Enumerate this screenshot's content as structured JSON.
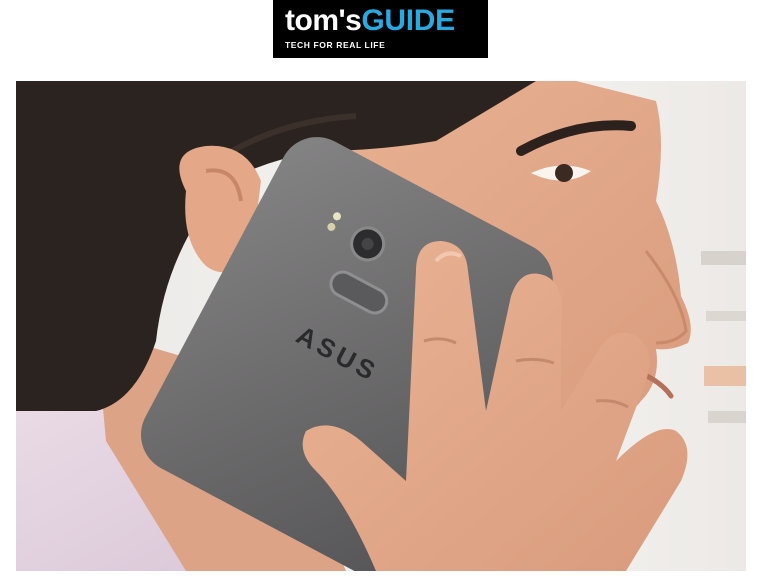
{
  "logo": {
    "brand_part1": "tom's",
    "brand_part2": "GUIDE",
    "tagline": "TECH FOR REAL LIFE"
  },
  "photo": {
    "phone_brand": "ASUS"
  },
  "colors": {
    "logo_background": "#000000",
    "logo_accent": "#29a9e1",
    "phone_body": "#6e6d6e"
  }
}
